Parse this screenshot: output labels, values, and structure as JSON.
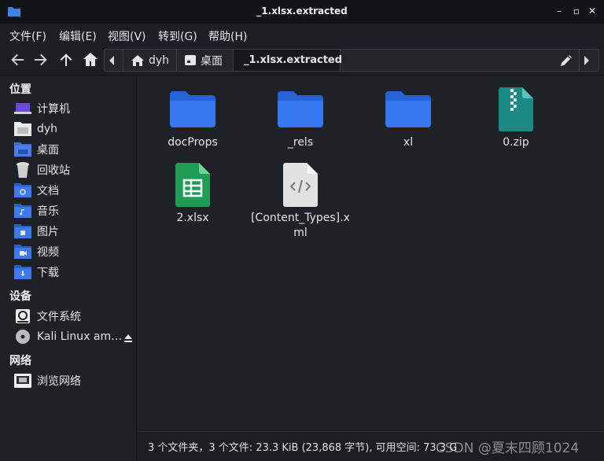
{
  "window": {
    "title": "_1.xlsx.extracted"
  },
  "menu": [
    "文件(F)",
    "编辑(E)",
    "视图(V)",
    "转到(G)",
    "帮助(H)"
  ],
  "path": {
    "segments": [
      "dyh",
      "桌面"
    ],
    "current": "_1.xlsx.extracted"
  },
  "sidebar": {
    "places_heading": "位置",
    "places": [
      {
        "label": "计算机",
        "icon": "computer-icon"
      },
      {
        "label": "dyh",
        "icon": "home-folder-icon"
      },
      {
        "label": "桌面",
        "icon": "desktop-folder-icon"
      },
      {
        "label": "回收站",
        "icon": "trash-icon"
      },
      {
        "label": "文档",
        "icon": "documents-folder-icon"
      },
      {
        "label": "音乐",
        "icon": "music-folder-icon"
      },
      {
        "label": "图片",
        "icon": "pictures-folder-icon"
      },
      {
        "label": "视频",
        "icon": "videos-folder-icon"
      },
      {
        "label": "下载",
        "icon": "downloads-folder-icon"
      }
    ],
    "devices_heading": "设备",
    "devices": [
      {
        "label": "文件系统",
        "icon": "drive-icon"
      },
      {
        "label": "Kali Linux am…",
        "icon": "disc-icon"
      }
    ],
    "network_heading": "网络",
    "network": [
      {
        "label": "浏览网络",
        "icon": "network-icon"
      }
    ]
  },
  "files": [
    {
      "name": "docProps",
      "type": "folder"
    },
    {
      "name": "_rels",
      "type": "folder"
    },
    {
      "name": "xl",
      "type": "folder"
    },
    {
      "name": "0.zip",
      "type": "zip"
    },
    {
      "name": "2.xlsx",
      "type": "spreadsheet"
    },
    {
      "name": "[Content_Types].xml",
      "name_lines": [
        "[Content_Types].x",
        "ml"
      ],
      "type": "xml"
    }
  ],
  "status": "3 个文件夹，3 个文件: 23.3 KiB (23,868 字节), 可用空间: 73.3 G",
  "watermark": "CSDN @夏末四顾1024",
  "colors": {
    "folder": "#2f6fe0",
    "zip": "#1c8a84",
    "spreadsheet": "#1f9d55",
    "xml": "#e0e0e0"
  }
}
